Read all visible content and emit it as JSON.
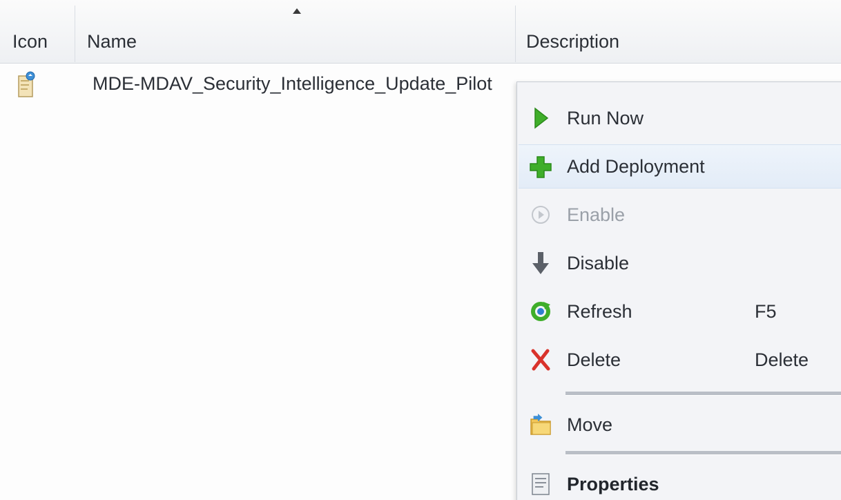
{
  "columns": {
    "icon": "Icon",
    "name": "Name",
    "description": "Description"
  },
  "list": {
    "rows": [
      {
        "name": "MDE-MDAV_Security_Intelligence_Update_Pilot",
        "icon": "task-sequence-icon"
      }
    ]
  },
  "context_menu": {
    "items": [
      {
        "label": "Run Now",
        "icon": "run-now-icon",
        "shortcut": ""
      },
      {
        "label": "Add Deployment",
        "icon": "add-deployment-icon",
        "shortcut": ""
      },
      {
        "label": "Enable",
        "icon": "enable-icon",
        "shortcut": "",
        "disabled": true
      },
      {
        "label": "Disable",
        "icon": "disable-icon",
        "shortcut": ""
      },
      {
        "label": "Refresh",
        "icon": "refresh-icon",
        "shortcut": "F5"
      },
      {
        "label": "Delete",
        "icon": "delete-icon",
        "shortcut": "Delete"
      },
      {
        "label": "Move",
        "icon": "move-icon",
        "shortcut": ""
      },
      {
        "label": "Properties",
        "icon": "properties-icon",
        "shortcut": ""
      }
    ]
  },
  "colors": {
    "run_green": "#3fae2a",
    "delete_red": "#d9322b",
    "hover_blue": "#e3ecf7"
  }
}
